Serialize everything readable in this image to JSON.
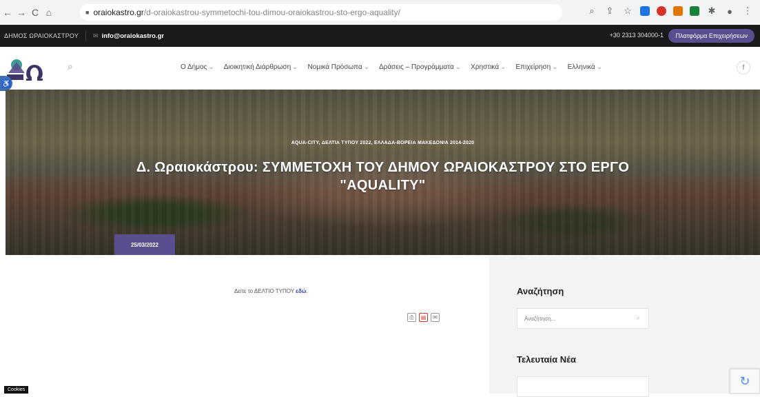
{
  "browser": {
    "back": "←",
    "forward": "→",
    "reload": "C",
    "home": "⌂",
    "lock": "🔒",
    "url_host": "oraiokastro.gr",
    "url_path": "/d-oraiokastrou-symmetochi-tou-dimou-oraiokastrou-sto-ergo-aquality/"
  },
  "topbar": {
    "org": "ΔΗΜΟΣ ΩΡΑΙΟΚΑΣΤΡΟΥ",
    "email": "info@oraiokastro.gr",
    "phone": "+30 2313 304000-1",
    "portal_button": "Πλατφόρμα Επιχειρήσεων"
  },
  "nav": {
    "items": [
      {
        "label": "Ο Δήμος"
      },
      {
        "label": "Διοικητική Διάρθρωση"
      },
      {
        "label": "Νομικά Πρόσωπα"
      },
      {
        "label": "Δράσεις – Προγράμματα"
      },
      {
        "label": "Χρηστικά"
      },
      {
        "label": "Επιχείρηση"
      },
      {
        "label": "Ελληνικά"
      }
    ],
    "fb": "f"
  },
  "hero": {
    "categories": "AQUA-CITY, ΔΕΛΤΙΑ ΤΥΠΟΥ 2022, ΕΛΛΑΔΑ-ΒΟΡΕΙΑ ΜΑΚΕΔΟΝΙΑ 2014-2020",
    "title_line1": "Δ. Ωραιοκάστρου: ΣΥΜΜΕΤΟΧΗ ΤΟΥ ΔΗΜΟΥ ΩΡΑΙΟΚΑΣΤΡΟΥ ΣΤΟ ΕΡΓΟ",
    "title_line2": "\"AQUALITY\"",
    "date": "25/03/2022"
  },
  "content": {
    "press_text": "Δείτε το ΔΕΛΤΙΟ ΤΥΠΟΥ",
    "press_link": "εδώ",
    "press_end": "."
  },
  "sidebar": {
    "search_title": "Αναζήτηση",
    "search_placeholder": "Αναζήτηση...",
    "news_title": "Τελευταία Νέα"
  },
  "footer": {
    "cookies": "Cookies"
  },
  "colors": {
    "accent": "#5a4f8e",
    "dark_strip": "#1a1a1a",
    "link": "#2a3fb5"
  }
}
